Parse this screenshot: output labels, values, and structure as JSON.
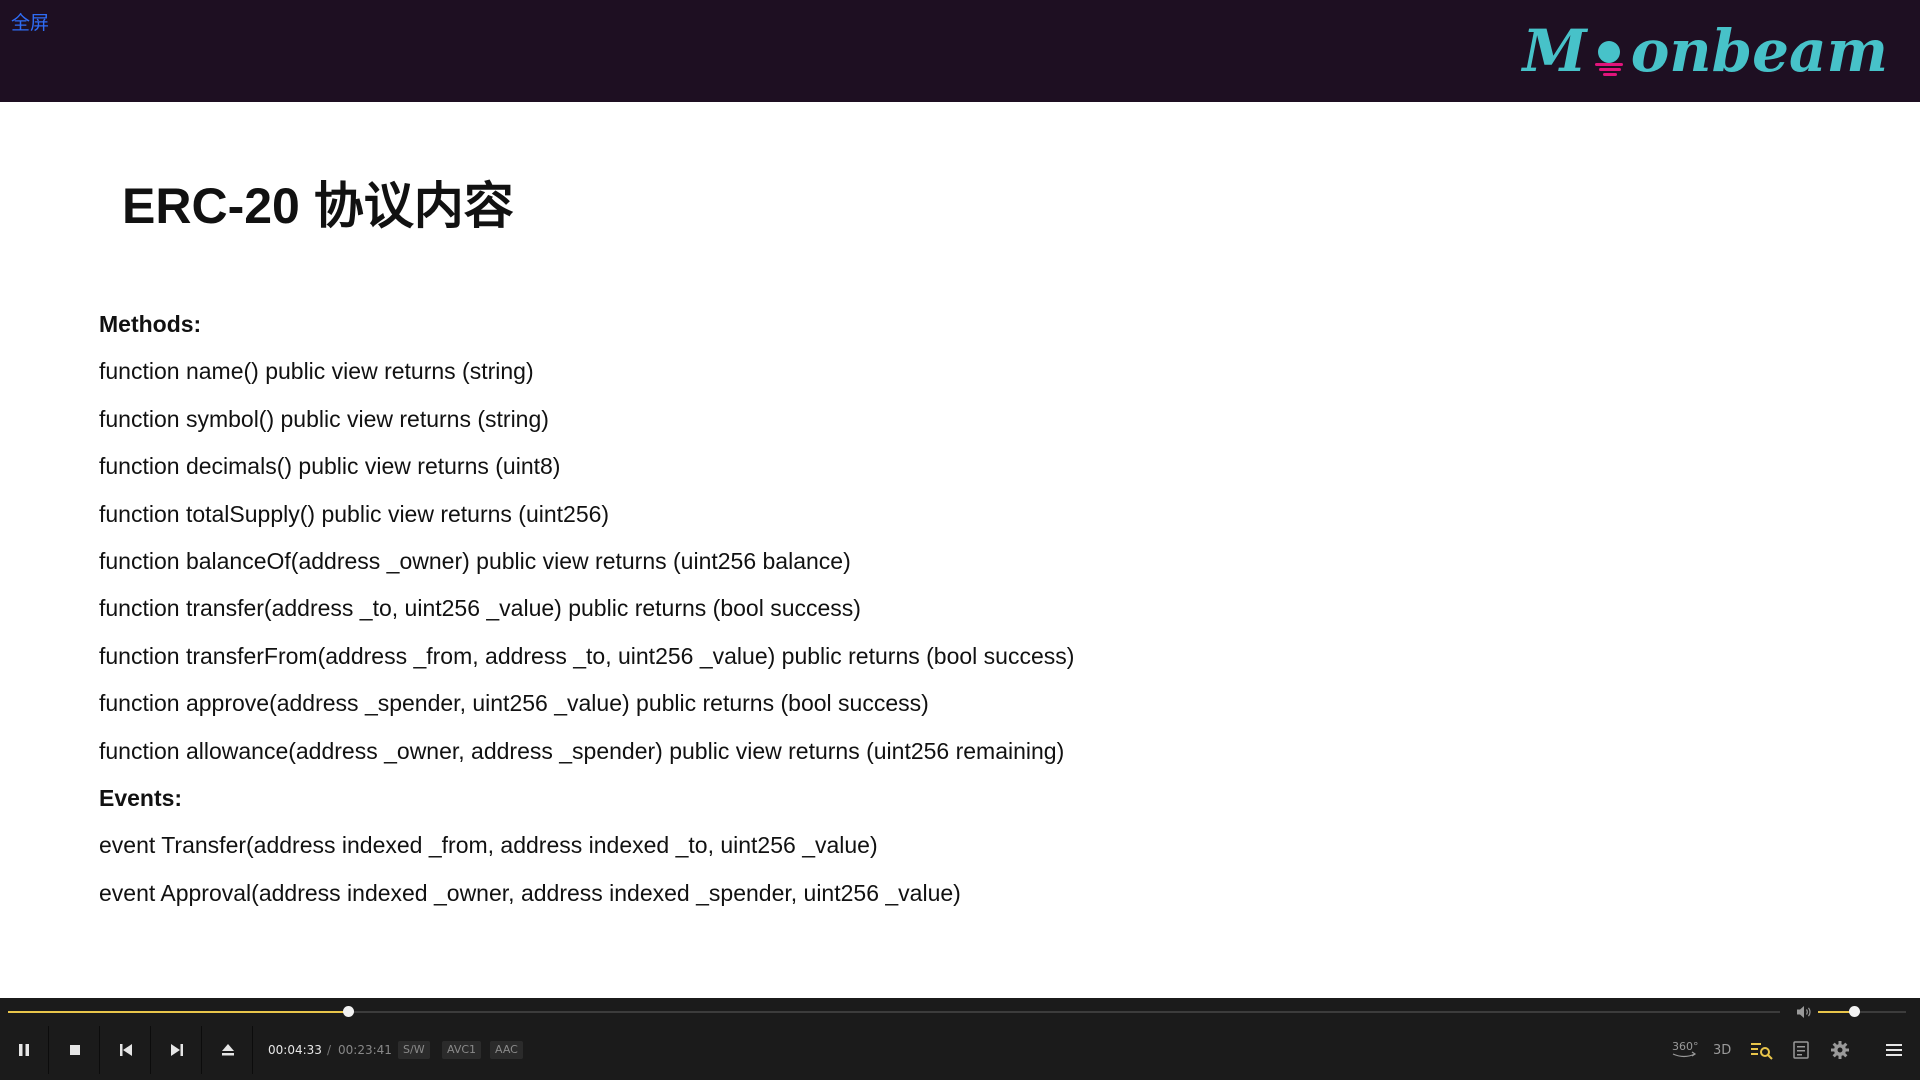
{
  "overlay": {
    "fullscreen_label": "全屏"
  },
  "slide": {
    "brand": {
      "logo_text_left": "M",
      "logo_text_right": "onbeam",
      "color": "#47c2c9",
      "moon_color": "#e1147b"
    },
    "title": "ERC-20 协议内容",
    "lines": [
      {
        "text": "Methods:",
        "heading": true
      },
      {
        "text": "function name() public view returns (string)",
        "heading": false
      },
      {
        "text": "function symbol() public view returns (string)",
        "heading": false
      },
      {
        "text": "function decimals() public view returns (uint8)",
        "heading": false
      },
      {
        "text": "function totalSupply() public view returns (uint256)",
        "heading": false
      },
      {
        "text": "function balanceOf(address _owner) public view returns (uint256 balance)",
        "heading": false
      },
      {
        "text": "function transfer(address _to, uint256 _value) public returns (bool success)",
        "heading": false
      },
      {
        "text": "function transferFrom(address _from, address _to, uint256 _value) public returns (bool success)",
        "heading": false
      },
      {
        "text": "function approve(address _spender, uint256 _value) public returns (bool success)",
        "heading": false
      },
      {
        "text": "function allowance(address _owner, address _spender) public view returns (uint256 remaining)",
        "heading": false
      },
      {
        "text": "Events:",
        "heading": true
      },
      {
        "text": "event Transfer(address indexed _from, address indexed _to, uint256 _value)",
        "heading": false
      },
      {
        "text": "event Approval(address indexed _owner, address indexed _spender, uint256 _value)",
        "heading": false
      }
    ]
  },
  "player": {
    "current_time": "00:04:33",
    "separator": "/",
    "total_time": "00:23:41",
    "progress_fraction": 0.192,
    "volume_fraction": 0.405,
    "accent_color": "#e9c54a",
    "badges": [
      "S/W",
      "AVC1",
      "AAC"
    ],
    "buttons": [
      "pause-icon",
      "stop-icon",
      "previous-icon",
      "next-icon",
      "eject-icon"
    ],
    "right_icons": [
      "360-icon",
      "3d-icon",
      "playlist-search-icon",
      "subtitle-icon",
      "settings-icon",
      "menu-icon"
    ],
    "right_labels": {
      "vr": "360°",
      "stereo": "3D"
    }
  }
}
